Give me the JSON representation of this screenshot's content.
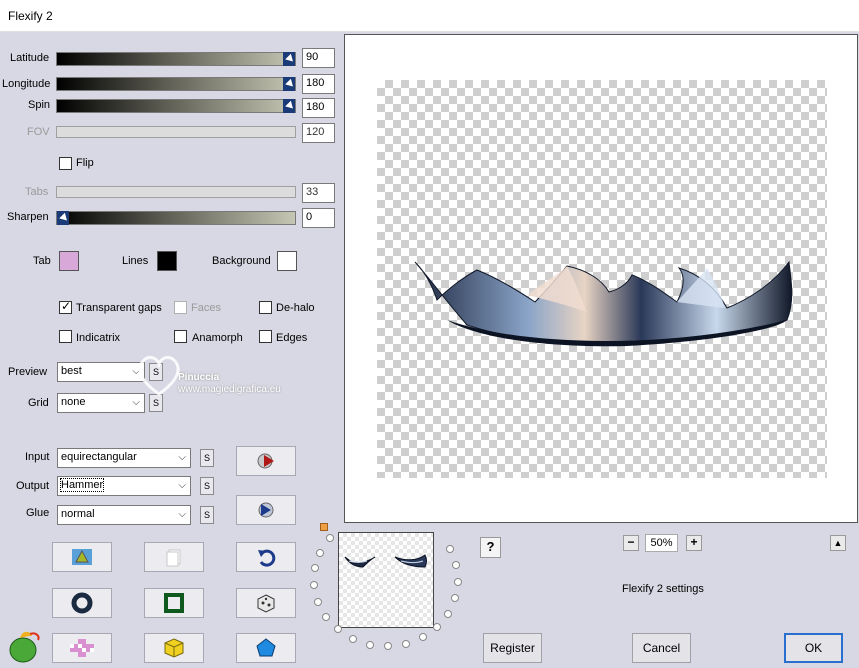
{
  "window": {
    "title": "Flexify 2"
  },
  "sliders": [
    {
      "label": "Latitude",
      "value": "90",
      "enabled": true
    },
    {
      "label": "Longitude",
      "value": "180",
      "enabled": true
    },
    {
      "label": "Spin",
      "value": "180",
      "enabled": true
    },
    {
      "label": "FOV",
      "value": "120",
      "enabled": false
    }
  ],
  "flip": {
    "label": "Flip",
    "checked": false
  },
  "tabs_slider": {
    "label": "Tabs",
    "value": "33",
    "enabled": false
  },
  "sharpen_slider": {
    "label": "Sharpen",
    "value": "0",
    "enabled": true
  },
  "colors": {
    "tab": {
      "label": "Tab",
      "color": "#d8a8d8"
    },
    "lines": {
      "label": "Lines",
      "color": "#000000"
    },
    "background": {
      "label": "Background",
      "color": "#ffffff"
    }
  },
  "options": {
    "transparent_gaps": {
      "label": "Transparent gaps",
      "checked": true
    },
    "faces": {
      "label": "Faces",
      "checked": false,
      "enabled": false
    },
    "de_halo": {
      "label": "De-halo",
      "checked": false
    },
    "indicatrix": {
      "label": "Indicatrix",
      "checked": false
    },
    "anamorph": {
      "label": "Anamorph",
      "checked": false
    },
    "edges": {
      "label": "Edges",
      "checked": false
    }
  },
  "preview": {
    "label": "Preview",
    "value": "best"
  },
  "grid": {
    "label": "Grid",
    "value": "none"
  },
  "input": {
    "label": "Input",
    "value": "equirectangular"
  },
  "output": {
    "label": "Output",
    "value": "Hammer"
  },
  "glue": {
    "label": "Glue",
    "value": "normal"
  },
  "s_label": "S",
  "zoom": {
    "minus": "−",
    "value": "50%",
    "plus": "+"
  },
  "help_label": "?",
  "scroll_up_label": "▲",
  "settings_text": "Flexify 2 settings",
  "buttons": {
    "register": "Register",
    "cancel": "Cancel",
    "ok": "OK"
  },
  "watermark": {
    "line1": "Pinuccia",
    "line2": "www.magiedigrafica.eu"
  }
}
